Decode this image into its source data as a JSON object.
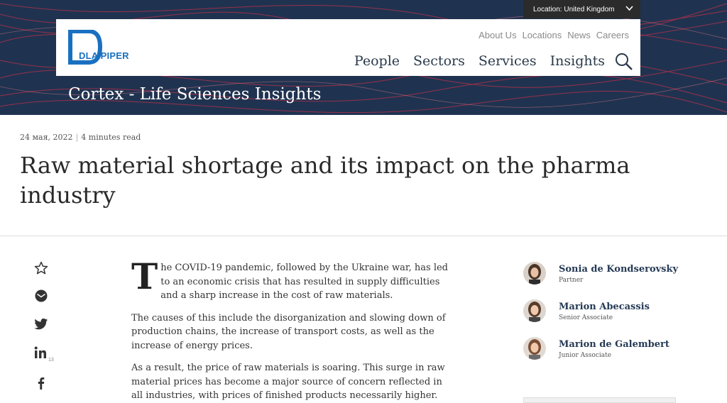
{
  "header": {
    "location_label": "Location: United Kingdom",
    "logo_text": "DLA PIPER",
    "top_links": [
      "About Us",
      "Locations",
      "News",
      "Careers"
    ],
    "main_nav": [
      "People",
      "Sectors",
      "Services",
      "Insights"
    ],
    "section_title": "Cortex - Life Sciences Insights"
  },
  "article": {
    "date": "24 мая, 2022",
    "read_time": "4 minutes read",
    "title": "Raw material shortage and its impact on the pharma industry",
    "dropcap": "T",
    "paragraphs": [
      "he COVID-19 pandemic, followed by the Ukraine war, has led to an economic crisis that has resulted in supply difficulties and a sharp increase in the cost of raw materials.",
      "The causes of this include the disorganization and slowing down of production chains, the increase of transport costs, as well as the increase of energy prices.",
      "As a result, the price of raw materials is soaring. This surge in raw material prices has become a major source of concern reflected in all industries, with prices of finished products necessarily higher."
    ]
  },
  "share": {
    "icons": [
      "star-icon",
      "email-icon",
      "twitter-icon",
      "linkedin-icon",
      "facebook-icon"
    ],
    "linkedin_count": "13"
  },
  "authors": [
    {
      "name": "Sonia de Kondserovsky",
      "role": "Partner"
    },
    {
      "name": "Marion Abecassis",
      "role": "Senior Associate"
    },
    {
      "name": "Marion de Galembert",
      "role": "Junior Associate"
    }
  ],
  "colors": {
    "banner": "#1f3350",
    "wave_accent": "#c0304a",
    "brand_blue": "#1a70c0",
    "author_name": "#253a55"
  }
}
